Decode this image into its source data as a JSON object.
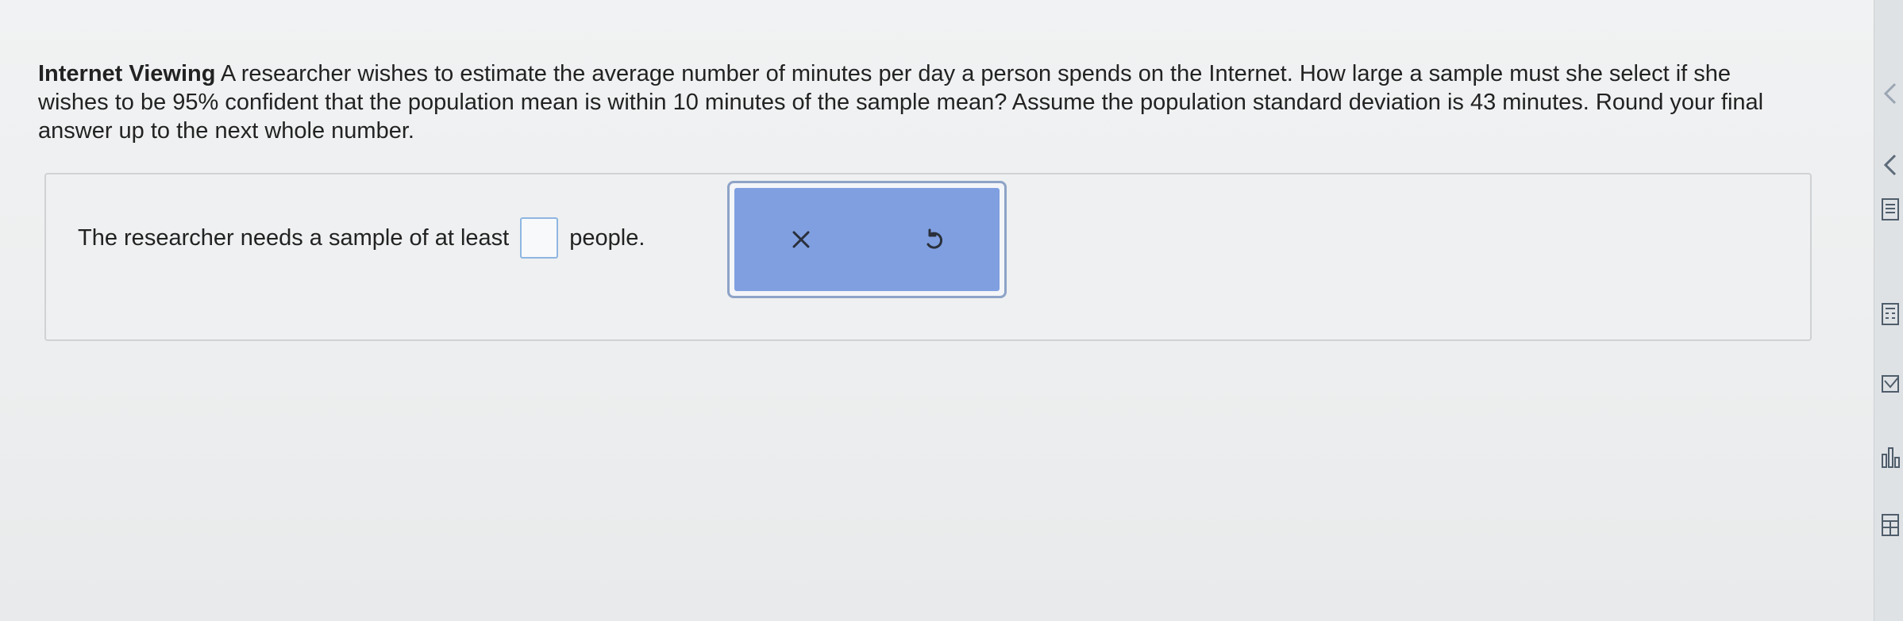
{
  "question": {
    "title": "Internet Viewing",
    "text": "A researcher wishes to estimate the average number of minutes per day a person spends on the Internet. How large a sample must she select if she wishes to be 95% confident that the population mean is within 10 minutes of the sample mean? Assume the population standard deviation is 43 minutes. Round your final answer up to the next whole number."
  },
  "answer": {
    "prefix": "The researcher needs a sample of at least",
    "suffix": "people.",
    "value": ""
  },
  "actions": {
    "clear_icon": "close-icon",
    "undo_icon": "undo-icon"
  },
  "right_rail": {
    "icons": [
      "chevron-left-icon",
      "chevron-left-icon",
      "document-icon",
      "calculator-icon",
      "checkbox-icon",
      "chart-icon",
      "table-icon"
    ]
  },
  "colors": {
    "action_bg": "#7f9fe0",
    "input_border": "#8fb6e2"
  }
}
